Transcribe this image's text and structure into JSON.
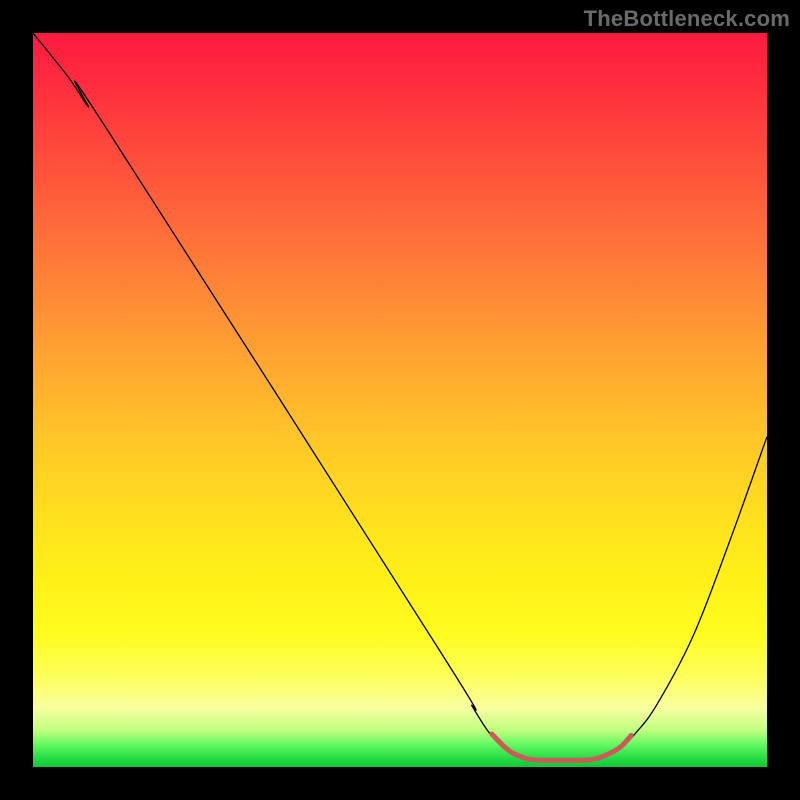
{
  "watermark": "TheBottleneck.com",
  "chart_data": {
    "type": "line",
    "title": "",
    "xlabel": "",
    "ylabel": "",
    "xlim": [
      0,
      100
    ],
    "ylim": [
      0,
      100
    ],
    "grid": false,
    "curve": {
      "color": "#000000",
      "width": 1.3,
      "points": [
        {
          "x": 0.0,
          "y": 100.0
        },
        {
          "x": 4.8,
          "y": 94.0
        },
        {
          "x": 7.5,
          "y": 90.0
        },
        {
          "x": 10.0,
          "y": 87.0
        },
        {
          "x": 55.0,
          "y": 16.5
        },
        {
          "x": 60.0,
          "y": 8.0
        },
        {
          "x": 62.5,
          "y": 4.2
        },
        {
          "x": 64.5,
          "y": 2.3
        },
        {
          "x": 66.0,
          "y": 1.4
        },
        {
          "x": 68.0,
          "y": 1.0
        },
        {
          "x": 72.0,
          "y": 0.9
        },
        {
          "x": 76.0,
          "y": 1.0
        },
        {
          "x": 78.0,
          "y": 1.4
        },
        {
          "x": 80.0,
          "y": 2.5
        },
        {
          "x": 82.0,
          "y": 4.5
        },
        {
          "x": 85.0,
          "y": 8.5
        },
        {
          "x": 90.0,
          "y": 18.0
        },
        {
          "x": 95.0,
          "y": 31.0
        },
        {
          "x": 100.0,
          "y": 45.0
        }
      ]
    },
    "flat_marker": {
      "color": "#cc5a5a",
      "width": 5,
      "points": [
        {
          "x": 62.5,
          "y": 4.5
        },
        {
          "x": 64.5,
          "y": 2.5
        },
        {
          "x": 66.0,
          "y": 1.6
        },
        {
          "x": 68.0,
          "y": 1.0
        },
        {
          "x": 72.0,
          "y": 0.9
        },
        {
          "x": 76.0,
          "y": 1.0
        },
        {
          "x": 78.0,
          "y": 1.6
        },
        {
          "x": 80.0,
          "y": 2.7
        },
        {
          "x": 81.5,
          "y": 4.3
        }
      ]
    }
  }
}
